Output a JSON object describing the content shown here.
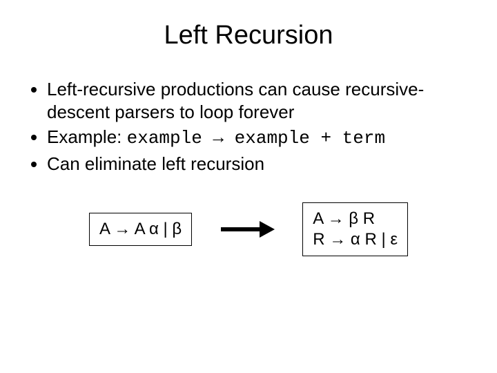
{
  "title": "Left Recursion",
  "bullets": {
    "b1": "Left-recursive productions can cause recursive-descent parsers to loop forever",
    "b2_prefix": "Example: ",
    "b2_code": "example → example + term",
    "b3": "Can eliminate left recursion"
  },
  "left_box": "A → A α | β",
  "right_box": "A → β R\nR → α R | ε"
}
